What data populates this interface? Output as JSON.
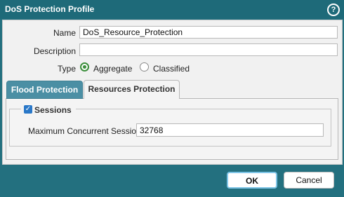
{
  "dialog": {
    "title": "DoS Protection Profile",
    "help_icon": "question-circle-icon",
    "help_glyph": "?"
  },
  "form": {
    "name_label": "Name",
    "name_value": "DoS_Resource_Protection",
    "description_label": "Description",
    "description_value": "",
    "type_label": "Type",
    "type_options": [
      {
        "label": "Aggregate",
        "selected": true
      },
      {
        "label": "Classified",
        "selected": false
      }
    ]
  },
  "tabs": [
    {
      "label": "Flood Protection",
      "active": false
    },
    {
      "label": "Resources Protection",
      "active": true
    }
  ],
  "resources": {
    "sessions_label": "Sessions",
    "sessions_checked": true,
    "checkbox_glyph": "✓",
    "max_sessions_label": "Maximum Concurrent Sessions",
    "max_sessions_value": "32768"
  },
  "buttons": {
    "ok_label": "OK",
    "cancel_label": "Cancel"
  },
  "colors": {
    "title_bar": "#1e6a79",
    "background": "#23707f",
    "radio_selected": "#3b8e3b",
    "tab_inactive": "#4b8fa4",
    "checkbox": "#2a78c8",
    "ok_border": "#7ec4e6"
  }
}
